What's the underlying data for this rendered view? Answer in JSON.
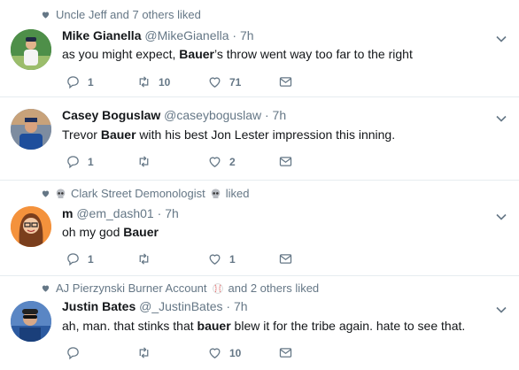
{
  "tweets": [
    {
      "context": "Uncle Jeff and 7 others liked",
      "context_pre": "",
      "context_post": "",
      "name": "Mike Gianella",
      "handle": "@MikeGianella",
      "dot": "·",
      "time": "7h",
      "text_before": "as you might expect, ",
      "text_bold": "Bauer",
      "text_after": "’s throw went way too far to the right",
      "replies": "1",
      "retweets": "10",
      "likes": "71"
    },
    {
      "context": "",
      "name": "Casey Boguslaw",
      "handle": "@caseyboguslaw",
      "dot": "·",
      "time": "7h",
      "text_before": "Trevor ",
      "text_bold": "Bauer",
      "text_after": " with his best Jon Lester impression this inning.",
      "replies": "1",
      "retweets": "",
      "likes": "2"
    },
    {
      "context": "Clark Street Demonologist",
      "context_suffix": "liked",
      "name": "m",
      "handle": "@em_dash01",
      "dot": "·",
      "time": "7h",
      "text_before": "oh my god ",
      "text_bold": "Bauer",
      "text_after": "",
      "replies": "1",
      "retweets": "",
      "likes": "1"
    },
    {
      "context": "AJ Pierzynski Burner Account",
      "context_suffix": "and 2 others liked",
      "name": "Justin Bates",
      "handle": "@_JustinBates",
      "dot": "·",
      "time": "7h",
      "text_before": "ah, man. that stinks that ",
      "text_bold": "bauer",
      "text_after": " blew it for the tribe again. hate to see that.",
      "replies": "",
      "retweets": "",
      "likes": "10"
    }
  ],
  "colors": {
    "text": "#14171a",
    "muted": "#657786",
    "border": "#e6ecf0"
  },
  "icons": [
    "heart-icon",
    "reply-icon",
    "retweet-icon",
    "like-icon",
    "dm-icon",
    "chevron-down-icon",
    "skull-icon",
    "baseball-icon"
  ]
}
